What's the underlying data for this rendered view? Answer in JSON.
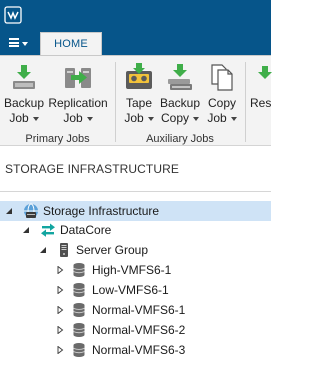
{
  "tabs": {
    "home": "HOME"
  },
  "ribbon": {
    "buttons": [
      {
        "line1": "Backup",
        "line2": "Job",
        "icon": "backup-job-icon"
      },
      {
        "line1": "Replication",
        "line2": "Job",
        "icon": "replication-job-icon"
      },
      {
        "line1": "Tape",
        "line2": "Job",
        "icon": "tape-job-icon"
      },
      {
        "line1": "Backup",
        "line2": "Copy",
        "icon": "backup-copy-icon"
      },
      {
        "line1": "Copy",
        "line2": "Job",
        "icon": "copy-job-icon"
      },
      {
        "line1": "Res",
        "line2": "",
        "icon": "restore-icon"
      }
    ],
    "groups": {
      "primary": "Primary Jobs",
      "auxiliary": "Auxiliary Jobs"
    }
  },
  "section": {
    "title": "STORAGE INFRASTRUCTURE"
  },
  "tree": {
    "root": "Storage Infrastructure",
    "datacore": "DataCore",
    "server_group": "Server Group",
    "volumes": [
      "High-VMFS6-1",
      "Low-VMFS6-1",
      "Normal-VMFS6-1",
      "Normal-VMFS6-2",
      "Normal-VMFS6-3"
    ]
  },
  "colors": {
    "titlebar": "#06558a",
    "selection": "#cfe3f6",
    "accent_green": "#3fae49",
    "datacore_teal": "#12a5a0"
  }
}
